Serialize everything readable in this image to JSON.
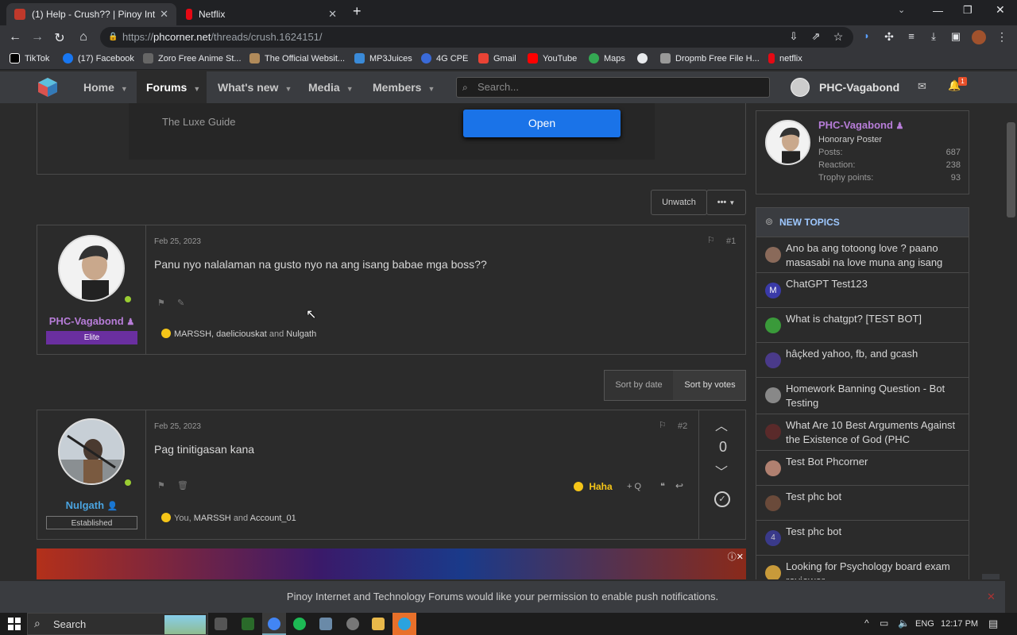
{
  "browser": {
    "tabs": [
      {
        "title": "(1) Help - Crush?? | Pinoy Int",
        "active": true
      },
      {
        "title": "Netflix",
        "active": false
      }
    ],
    "url_scheme": "https://",
    "url_host": "phcorner.net",
    "url_path": "/threads/crush.1624151/",
    "bookmarks": [
      "TikTok",
      "(17) Facebook",
      "Zoro Free Anime St...",
      "The Official Websit...",
      "MP3Juices",
      "4G CPE",
      "Gmail",
      "YouTube",
      "Maps",
      "Dropmb Free File H...",
      "netflix"
    ]
  },
  "site_nav": {
    "items": [
      "Home",
      "Forums",
      "What's new",
      "Media",
      "Members"
    ],
    "search_placeholder": "Search...",
    "username": "PHC-Vagabond",
    "alert_count": "1"
  },
  "ad_box": {
    "title": "The Luxe Guide",
    "open_label": "Open"
  },
  "thread_controls": {
    "unwatch": "Unwatch",
    "more": "•••"
  },
  "posts": [
    {
      "author": "PHC-Vagabond",
      "badge": "Elite",
      "date": "Feb 25, 2023",
      "number": "#1",
      "body": "Panu nyo nalalaman na gusto nyo na ang isang babae mga boss??",
      "reactions": {
        "names": "MARSSH, daeliciouskat",
        "and": "and",
        "last": "Nulgath"
      }
    },
    {
      "author": "Nulgath",
      "badge": "Established",
      "date": "Feb 25, 2023",
      "number": "#2",
      "body": "Pag tinitigasan kana",
      "votes": "0",
      "haha_label": "Haha",
      "quote_label": "+ Q",
      "reactions": {
        "you": "You",
        "names": "MARSSH",
        "and": "and",
        "last": "Account_01"
      }
    }
  ],
  "sort": {
    "by_date": "Sort by date",
    "by_votes": "Sort by votes"
  },
  "profile_card": {
    "name": "PHC-Vagabond",
    "title": "Honorary Poster",
    "stats": [
      {
        "label": "Posts:",
        "value": "687"
      },
      {
        "label": "Reaction:",
        "value": "238"
      },
      {
        "label": "Trophy points:",
        "value": "93"
      }
    ]
  },
  "new_topics": {
    "heading": "NEW TOPICS",
    "items": [
      {
        "title": "Ano ba ang totoong love ? paano masasabi na love muna ang isang",
        "color": "#8a6a5a"
      },
      {
        "title": "ChatGPT Test123",
        "color": "#3a3aa8",
        "letter": "M"
      },
      {
        "title": "What is chatgpt? [TEST BOT]",
        "color": "#3a9a3a"
      },
      {
        "title": "hâçked yahoo, fb, and gcash",
        "color": "#4a3a8a"
      },
      {
        "title": "Homework Banning Question - Bot Testing",
        "color": "#888888"
      },
      {
        "title": "What Are 10 Best Arguments Against the Existence of God (PHC",
        "color": "#5a2a2a"
      },
      {
        "title": "Test Bot Phcorner",
        "color": "#b08070"
      },
      {
        "title": "Test phc bot",
        "color": "#6a4a3a"
      },
      {
        "title": "Test phc bot",
        "color": "#3a3a8a",
        "letter": "4"
      },
      {
        "title": "Looking for Psychology board exam reviewer",
        "color": "#c89a3a"
      }
    ]
  },
  "push_notice": "Pinoy Internet and Technology Forums would like your permission to enable push notifications.",
  "taskbar": {
    "search": "Search",
    "lang": "ENG",
    "time": "12:17 PM"
  }
}
